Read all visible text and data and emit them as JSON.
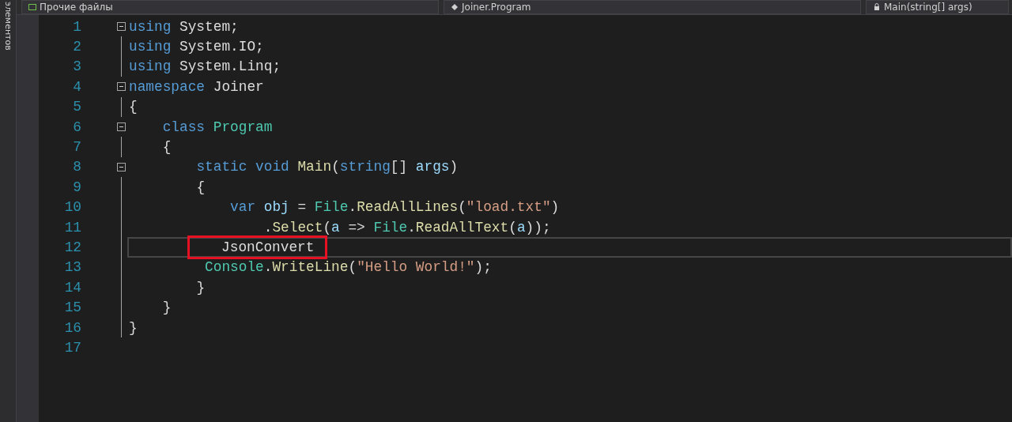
{
  "side_panel": {
    "label": "элементов"
  },
  "nav_bar": {
    "file_dropdown": "Прочие файлы",
    "class_dropdown": "Joiner.Program",
    "member_dropdown": "Main(string[] args)"
  },
  "editor": {
    "lines": [
      {
        "number": "1",
        "foldable": true,
        "current": false,
        "tokens": [
          {
            "kind": "keyword",
            "text": "using"
          },
          {
            "kind": "plain",
            "text": " System;"
          }
        ]
      },
      {
        "number": "2",
        "foldable": false,
        "current": false,
        "tokens": [
          {
            "kind": "keyword",
            "text": "using"
          },
          {
            "kind": "plain",
            "text": " System.IO;"
          }
        ]
      },
      {
        "number": "3",
        "foldable": false,
        "current": false,
        "tokens": [
          {
            "kind": "keyword",
            "text": "using"
          },
          {
            "kind": "plain",
            "text": " System.Linq;"
          }
        ]
      },
      {
        "number": "4",
        "foldable": true,
        "current": false,
        "tokens": [
          {
            "kind": "keyword",
            "text": "namespace"
          },
          {
            "kind": "plain",
            "text": " Joiner"
          }
        ]
      },
      {
        "number": "5",
        "foldable": false,
        "current": false,
        "tokens": [
          {
            "kind": "plain",
            "text": "{"
          }
        ]
      },
      {
        "number": "6",
        "foldable": true,
        "current": false,
        "tokens": [
          {
            "kind": "keyword",
            "text": "    class"
          },
          {
            "kind": "type",
            "text": " Program"
          }
        ]
      },
      {
        "number": "7",
        "foldable": false,
        "current": false,
        "tokens": [
          {
            "kind": "plain",
            "text": "    {"
          }
        ]
      },
      {
        "number": "8",
        "foldable": true,
        "current": false,
        "tokens": [
          {
            "kind": "keyword",
            "text": "        static void"
          },
          {
            "kind": "method",
            "text": " Main"
          },
          {
            "kind": "plain",
            "text": "("
          },
          {
            "kind": "keyword",
            "text": "string"
          },
          {
            "kind": "plain",
            "text": "[] "
          },
          {
            "kind": "variable",
            "text": "args"
          },
          {
            "kind": "plain",
            "text": ")"
          }
        ]
      },
      {
        "number": "9",
        "foldable": false,
        "current": false,
        "tokens": [
          {
            "kind": "plain",
            "text": "        {"
          }
        ]
      },
      {
        "number": "10",
        "foldable": false,
        "current": false,
        "tokens": [
          {
            "kind": "keyword",
            "text": "            var"
          },
          {
            "kind": "variable",
            "text": " obj"
          },
          {
            "kind": "plain",
            "text": " = "
          },
          {
            "kind": "type",
            "text": "File"
          },
          {
            "kind": "plain",
            "text": "."
          },
          {
            "kind": "method",
            "text": "ReadAllLines"
          },
          {
            "kind": "plain",
            "text": "("
          },
          {
            "kind": "string",
            "text": "\"load.txt\""
          },
          {
            "kind": "plain",
            "text": ")"
          }
        ]
      },
      {
        "number": "11",
        "foldable": false,
        "current": false,
        "tokens": [
          {
            "kind": "plain",
            "text": "                ."
          },
          {
            "kind": "method",
            "text": "Select"
          },
          {
            "kind": "plain",
            "text": "("
          },
          {
            "kind": "variable",
            "text": "a"
          },
          {
            "kind": "plain",
            "text": " => "
          },
          {
            "kind": "type",
            "text": "File"
          },
          {
            "kind": "plain",
            "text": "."
          },
          {
            "kind": "method",
            "text": "ReadAllText"
          },
          {
            "kind": "plain",
            "text": "("
          },
          {
            "kind": "variable",
            "text": "a"
          },
          {
            "kind": "plain",
            "text": "));"
          }
        ]
      },
      {
        "number": "12",
        "foldable": false,
        "current": true,
        "tokens": [
          {
            "kind": "plain",
            "text": "            JsonConvert",
            "highlighted": true
          }
        ]
      },
      {
        "number": "13",
        "foldable": false,
        "current": false,
        "tokens": [
          {
            "kind": "type",
            "text": "         Console"
          },
          {
            "kind": "plain",
            "text": "."
          },
          {
            "kind": "method",
            "text": "WriteLine"
          },
          {
            "kind": "plain",
            "text": "("
          },
          {
            "kind": "string",
            "text": "\"Hello World!\""
          },
          {
            "kind": "plain",
            "text": ");"
          }
        ]
      },
      {
        "number": "14",
        "foldable": false,
        "current": false,
        "tokens": [
          {
            "kind": "plain",
            "text": "        }"
          }
        ]
      },
      {
        "number": "15",
        "foldable": false,
        "current": false,
        "tokens": [
          {
            "kind": "plain",
            "text": "    }"
          }
        ]
      },
      {
        "number": "16",
        "foldable": false,
        "current": false,
        "tokens": [
          {
            "kind": "plain",
            "text": "}"
          }
        ]
      },
      {
        "number": "17",
        "foldable": false,
        "current": false
      }
    ]
  }
}
